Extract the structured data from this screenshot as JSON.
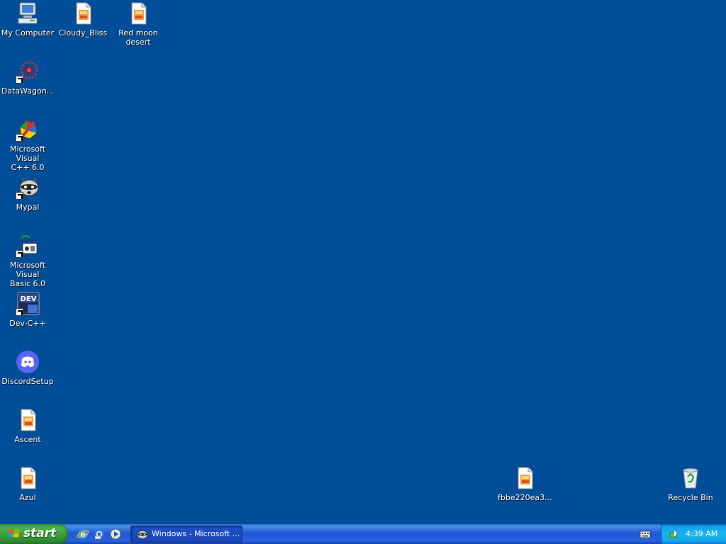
{
  "desktop": {
    "background_color": "#004E98",
    "icons": [
      {
        "label": "My Computer",
        "icon": "computer-icon"
      },
      {
        "label": "Cloudy_Bliss",
        "icon": "image-file-icon"
      },
      {
        "label": "Red moon\ndesert",
        "icon": "image-file-icon"
      },
      {
        "label": "DataWagon...",
        "icon": "datawagon-icon",
        "shortcut": true
      },
      {
        "label": "Microsoft Visual\nC++ 6.0",
        "icon": "visual-cpp-icon",
        "shortcut": true
      },
      {
        "label": "Mypal",
        "icon": "raccoon-icon",
        "shortcut": true
      },
      {
        "label": "Microsoft Visual\nBasic 6.0",
        "icon": "visual-basic-icon",
        "shortcut": true
      },
      {
        "label": "Dev-C++",
        "icon": "dev-cpp-icon",
        "shortcut": true
      },
      {
        "label": "DiscordSetup",
        "icon": "discord-icon"
      },
      {
        "label": "Ascent",
        "icon": "image-file-icon"
      },
      {
        "label": "Azul",
        "icon": "image-file-icon"
      },
      {
        "label": "fbbe220ea3...",
        "icon": "image-file-icon"
      },
      {
        "label": "Recycle Bin",
        "icon": "recycle-bin-icon"
      }
    ]
  },
  "taskbar": {
    "start_label": "start",
    "quick_launch": [
      "internet-explorer-icon",
      "outlook-express-icon",
      "media-player-icon"
    ],
    "task_button_label": "Windows - Microsoft ...",
    "clock": "4:39 AM",
    "accent_green": "#3c9a3c",
    "taskbar_blue": "#2157d7",
    "tray_blue": "#18b9ee"
  }
}
